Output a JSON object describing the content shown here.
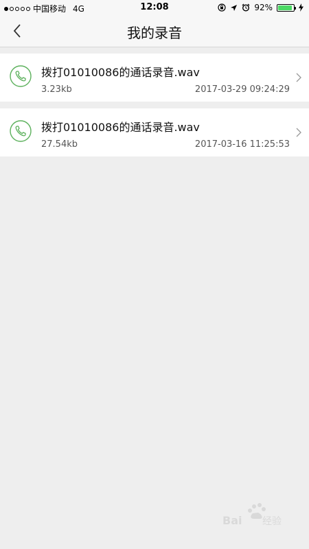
{
  "status_bar": {
    "carrier": "中国移动",
    "network": "4G",
    "time": "12:08",
    "battery": "92%",
    "battery_level": 0.92,
    "signal_bars_filled": 1,
    "icons": [
      "lock-rotation-icon",
      "location-icon",
      "alarm-icon",
      "battery-icon",
      "charging-icon"
    ]
  },
  "nav": {
    "title": "我的录音",
    "back_icon": "chevron-left-icon"
  },
  "recordings": [
    {
      "name": "拨打01010086的通话录音.wav",
      "size": "3.23kb",
      "time": "2017-03-29 09:24:29"
    },
    {
      "name": "拨打01010086的通话录音.wav",
      "size": "27.54kb",
      "time": "2017-03-16 11:25:53"
    }
  ],
  "colors": {
    "accent_green": "#5bb05b",
    "background": "#eeeeee",
    "battery_green": "#4cd964"
  },
  "watermark": {
    "text": "Baidu 经验"
  }
}
